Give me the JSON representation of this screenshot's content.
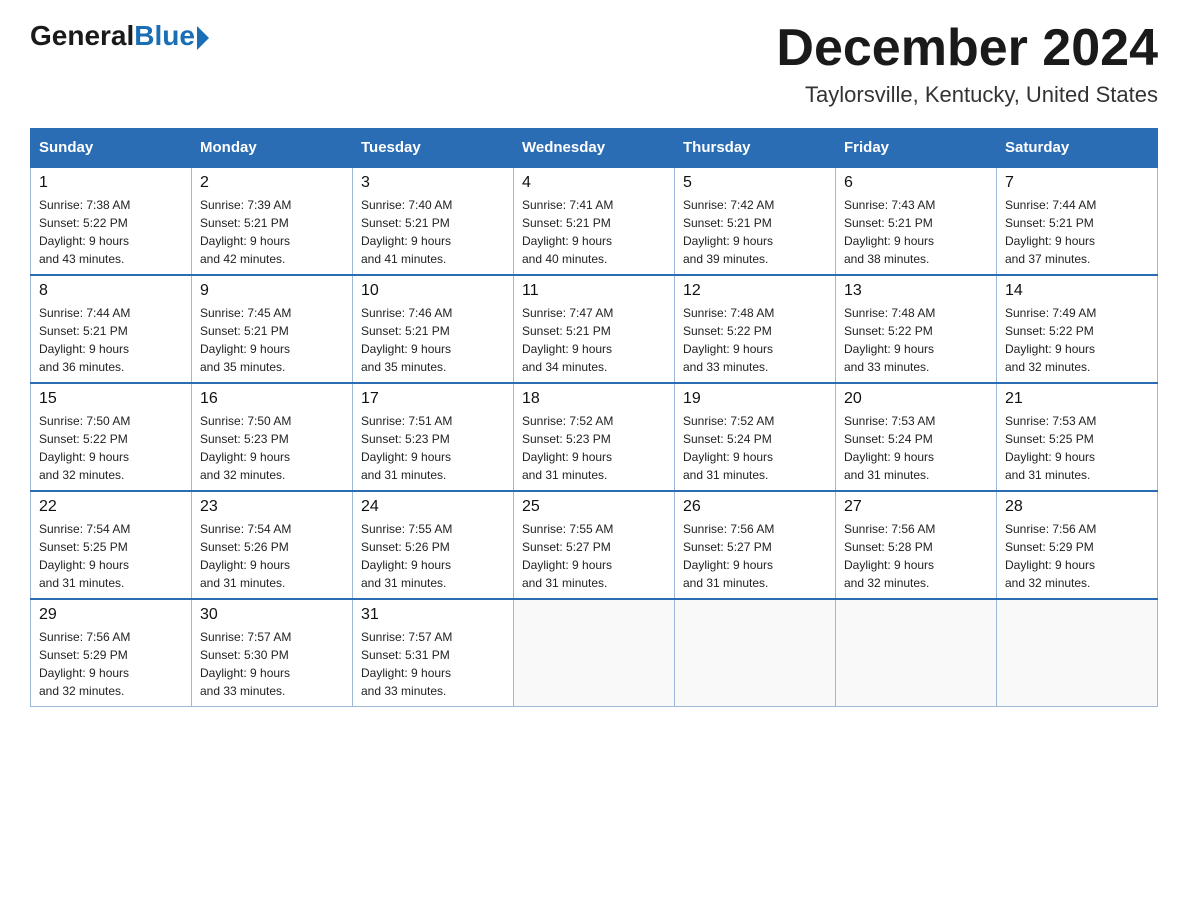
{
  "header": {
    "logo_general": "General",
    "logo_blue": "Blue",
    "month_title": "December 2024",
    "location": "Taylorsville, Kentucky, United States"
  },
  "calendar": {
    "days_of_week": [
      "Sunday",
      "Monday",
      "Tuesday",
      "Wednesday",
      "Thursday",
      "Friday",
      "Saturday"
    ],
    "weeks": [
      [
        {
          "day": "1",
          "sunrise": "7:38 AM",
          "sunset": "5:22 PM",
          "daylight": "9 hours and 43 minutes."
        },
        {
          "day": "2",
          "sunrise": "7:39 AM",
          "sunset": "5:21 PM",
          "daylight": "9 hours and 42 minutes."
        },
        {
          "day": "3",
          "sunrise": "7:40 AM",
          "sunset": "5:21 PM",
          "daylight": "9 hours and 41 minutes."
        },
        {
          "day": "4",
          "sunrise": "7:41 AM",
          "sunset": "5:21 PM",
          "daylight": "9 hours and 40 minutes."
        },
        {
          "day": "5",
          "sunrise": "7:42 AM",
          "sunset": "5:21 PM",
          "daylight": "9 hours and 39 minutes."
        },
        {
          "day": "6",
          "sunrise": "7:43 AM",
          "sunset": "5:21 PM",
          "daylight": "9 hours and 38 minutes."
        },
        {
          "day": "7",
          "sunrise": "7:44 AM",
          "sunset": "5:21 PM",
          "daylight": "9 hours and 37 minutes."
        }
      ],
      [
        {
          "day": "8",
          "sunrise": "7:44 AM",
          "sunset": "5:21 PM",
          "daylight": "9 hours and 36 minutes."
        },
        {
          "day": "9",
          "sunrise": "7:45 AM",
          "sunset": "5:21 PM",
          "daylight": "9 hours and 35 minutes."
        },
        {
          "day": "10",
          "sunrise": "7:46 AM",
          "sunset": "5:21 PM",
          "daylight": "9 hours and 35 minutes."
        },
        {
          "day": "11",
          "sunrise": "7:47 AM",
          "sunset": "5:21 PM",
          "daylight": "9 hours and 34 minutes."
        },
        {
          "day": "12",
          "sunrise": "7:48 AM",
          "sunset": "5:22 PM",
          "daylight": "9 hours and 33 minutes."
        },
        {
          "day": "13",
          "sunrise": "7:48 AM",
          "sunset": "5:22 PM",
          "daylight": "9 hours and 33 minutes."
        },
        {
          "day": "14",
          "sunrise": "7:49 AM",
          "sunset": "5:22 PM",
          "daylight": "9 hours and 32 minutes."
        }
      ],
      [
        {
          "day": "15",
          "sunrise": "7:50 AM",
          "sunset": "5:22 PM",
          "daylight": "9 hours and 32 minutes."
        },
        {
          "day": "16",
          "sunrise": "7:50 AM",
          "sunset": "5:23 PM",
          "daylight": "9 hours and 32 minutes."
        },
        {
          "day": "17",
          "sunrise": "7:51 AM",
          "sunset": "5:23 PM",
          "daylight": "9 hours and 31 minutes."
        },
        {
          "day": "18",
          "sunrise": "7:52 AM",
          "sunset": "5:23 PM",
          "daylight": "9 hours and 31 minutes."
        },
        {
          "day": "19",
          "sunrise": "7:52 AM",
          "sunset": "5:24 PM",
          "daylight": "9 hours and 31 minutes."
        },
        {
          "day": "20",
          "sunrise": "7:53 AM",
          "sunset": "5:24 PM",
          "daylight": "9 hours and 31 minutes."
        },
        {
          "day": "21",
          "sunrise": "7:53 AM",
          "sunset": "5:25 PM",
          "daylight": "9 hours and 31 minutes."
        }
      ],
      [
        {
          "day": "22",
          "sunrise": "7:54 AM",
          "sunset": "5:25 PM",
          "daylight": "9 hours and 31 minutes."
        },
        {
          "day": "23",
          "sunrise": "7:54 AM",
          "sunset": "5:26 PM",
          "daylight": "9 hours and 31 minutes."
        },
        {
          "day": "24",
          "sunrise": "7:55 AM",
          "sunset": "5:26 PM",
          "daylight": "9 hours and 31 minutes."
        },
        {
          "day": "25",
          "sunrise": "7:55 AM",
          "sunset": "5:27 PM",
          "daylight": "9 hours and 31 minutes."
        },
        {
          "day": "26",
          "sunrise": "7:56 AM",
          "sunset": "5:27 PM",
          "daylight": "9 hours and 31 minutes."
        },
        {
          "day": "27",
          "sunrise": "7:56 AM",
          "sunset": "5:28 PM",
          "daylight": "9 hours and 32 minutes."
        },
        {
          "day": "28",
          "sunrise": "7:56 AM",
          "sunset": "5:29 PM",
          "daylight": "9 hours and 32 minutes."
        }
      ],
      [
        {
          "day": "29",
          "sunrise": "7:56 AM",
          "sunset": "5:29 PM",
          "daylight": "9 hours and 32 minutes."
        },
        {
          "day": "30",
          "sunrise": "7:57 AM",
          "sunset": "5:30 PM",
          "daylight": "9 hours and 33 minutes."
        },
        {
          "day": "31",
          "sunrise": "7:57 AM",
          "sunset": "5:31 PM",
          "daylight": "9 hours and 33 minutes."
        },
        null,
        null,
        null,
        null
      ]
    ],
    "labels": {
      "sunrise": "Sunrise:",
      "sunset": "Sunset:",
      "daylight": "Daylight:"
    }
  }
}
